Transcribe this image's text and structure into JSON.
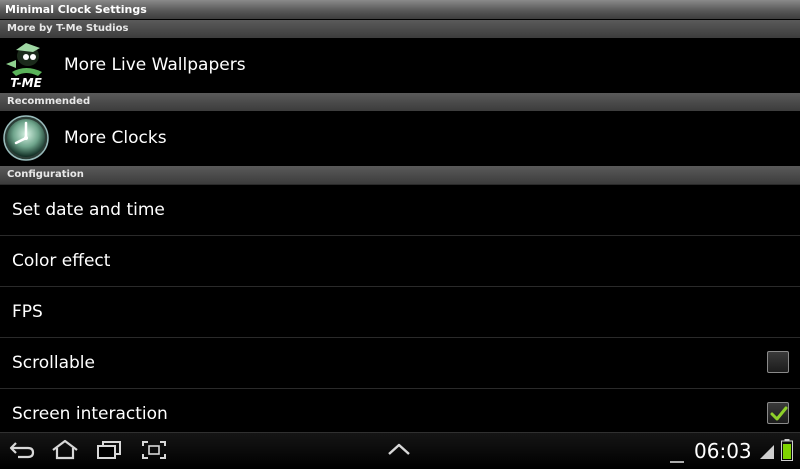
{
  "window": {
    "title": "Minimal Clock Settings"
  },
  "sections": {
    "more_by": "More by T-Me Studios",
    "recommended": "Recommended",
    "configuration": "Configuration"
  },
  "promos": {
    "wallpapers_label": "More Live Wallpapers",
    "wallpapers_logo_text": "T-ME",
    "clocks_label": "More Clocks"
  },
  "settings": {
    "items": [
      {
        "label": "Set date and time"
      },
      {
        "label": "Color effect"
      },
      {
        "label": "FPS"
      },
      {
        "label": "Scrollable",
        "checked": false
      },
      {
        "label": "Screen interaction",
        "checked": true
      }
    ]
  },
  "status": {
    "time": "06:03",
    "battery": "charging"
  },
  "colors": {
    "accent_check": "#8fd12a",
    "battery": "#7fd400"
  }
}
